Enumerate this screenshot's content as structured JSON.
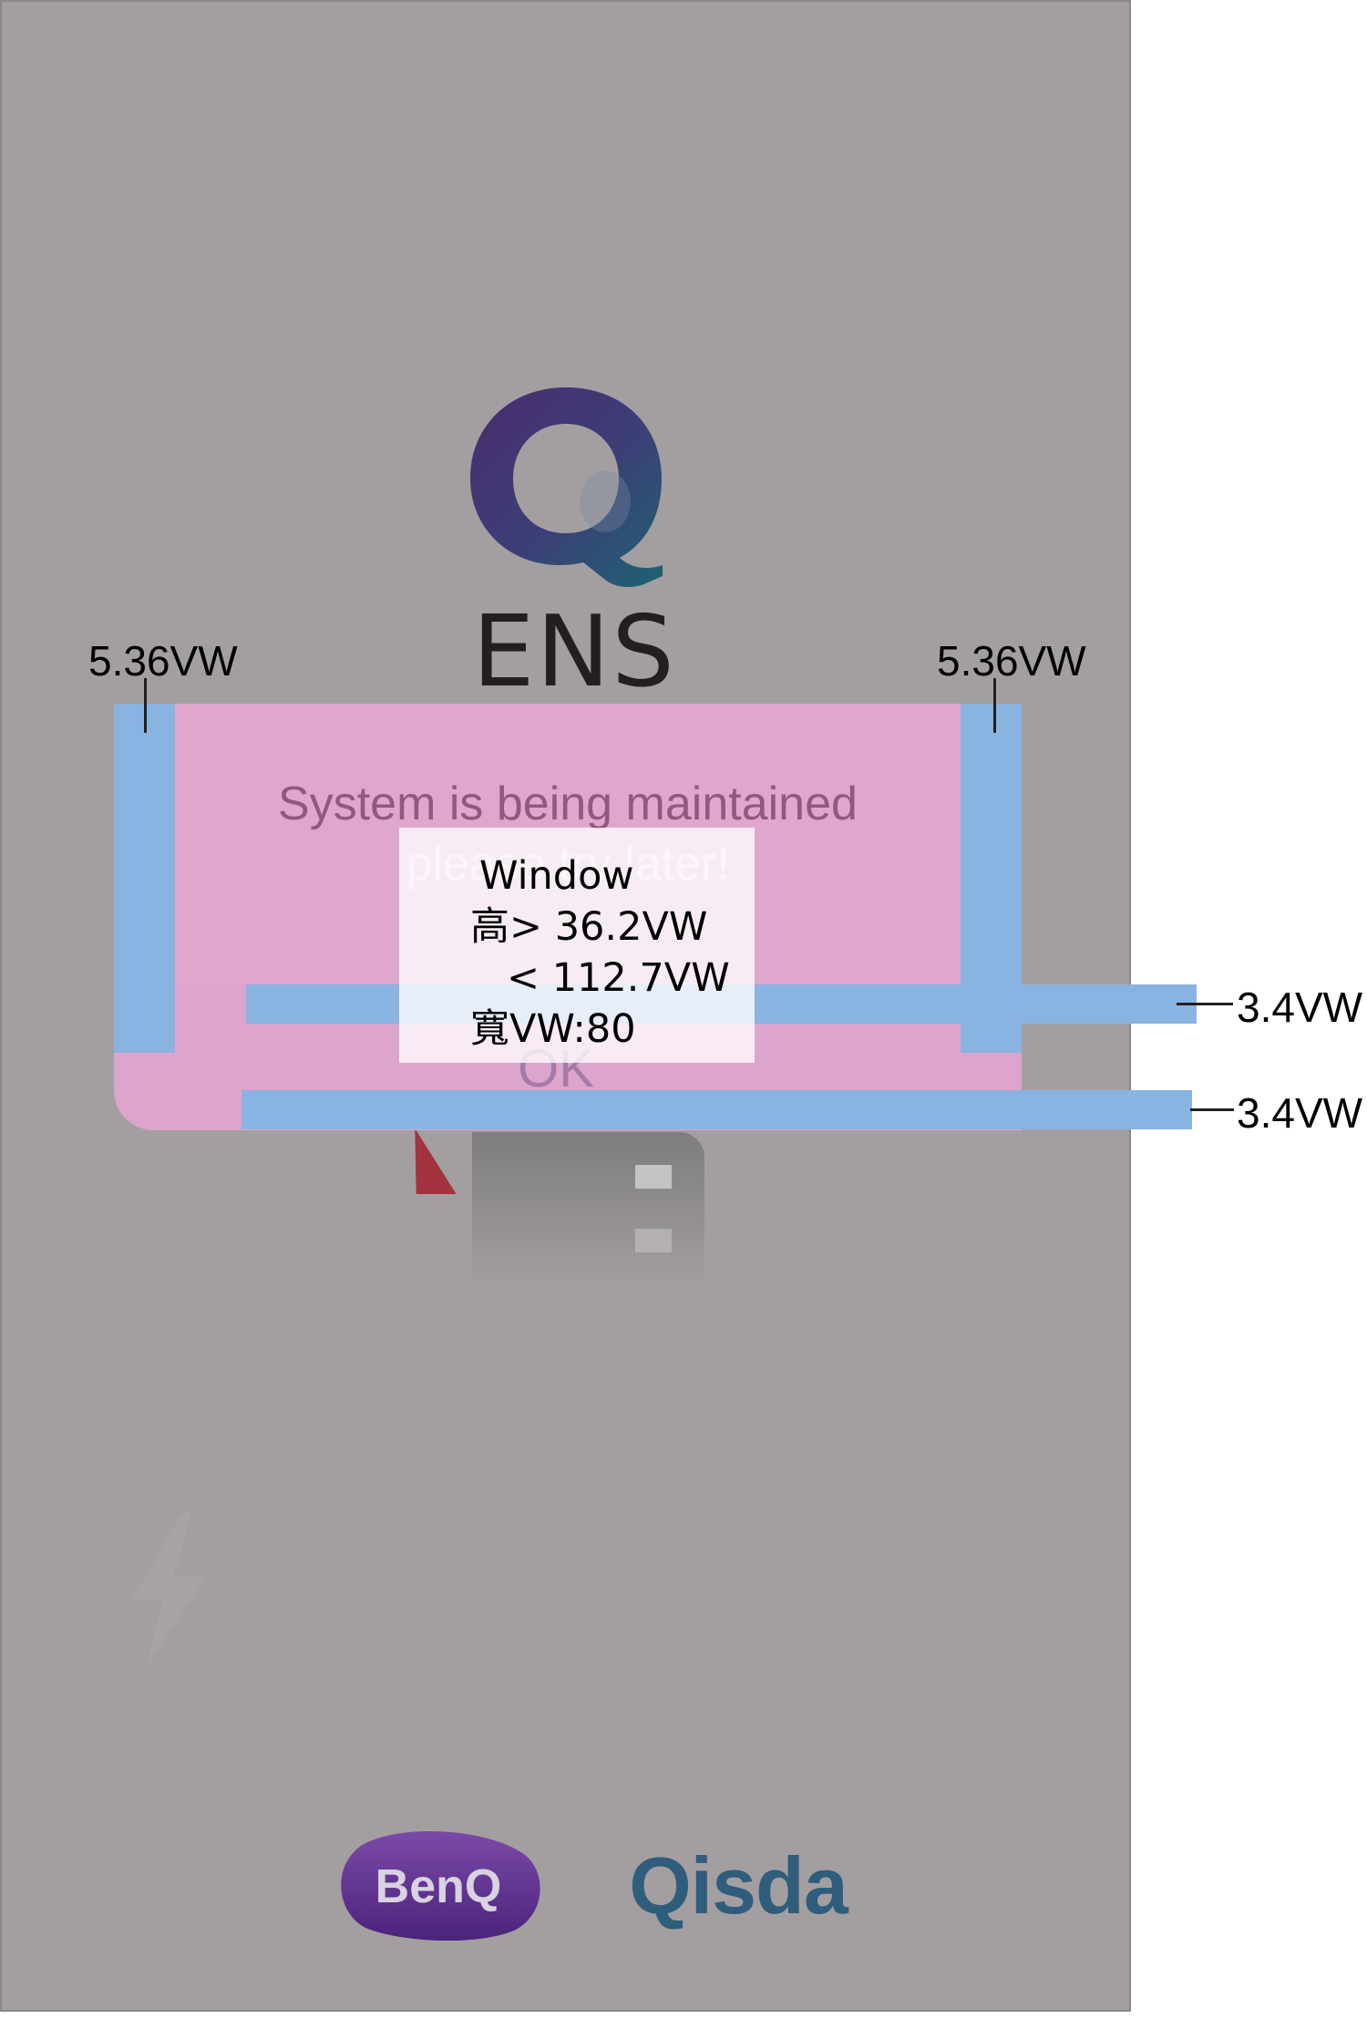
{
  "brand": {
    "app_logo_text": "ENS",
    "app_logo_icon": "q-logo-icon",
    "footer_logos": [
      "BenQ",
      "Qisda"
    ]
  },
  "dialog": {
    "message_line1": "System is being maintained",
    "message_line2": "please try later!",
    "ok_label": "OK"
  },
  "annotations": {
    "left_side_width": "5.36VW",
    "right_side_width": "5.36VW",
    "row_height_1": "3.4VW",
    "row_height_2": "3.4VW",
    "window_title": "Window",
    "height_min": "高> 36.2VW",
    "height_max": "< 112.7VW",
    "width": "寬VW:80"
  },
  "colors": {
    "background": "#a39fa0",
    "dialog": "#dda5cb",
    "measure_bar": "#89b3e1",
    "qisda_blue": "#2f5d7c",
    "benq_purple": "#5b2d8a"
  }
}
